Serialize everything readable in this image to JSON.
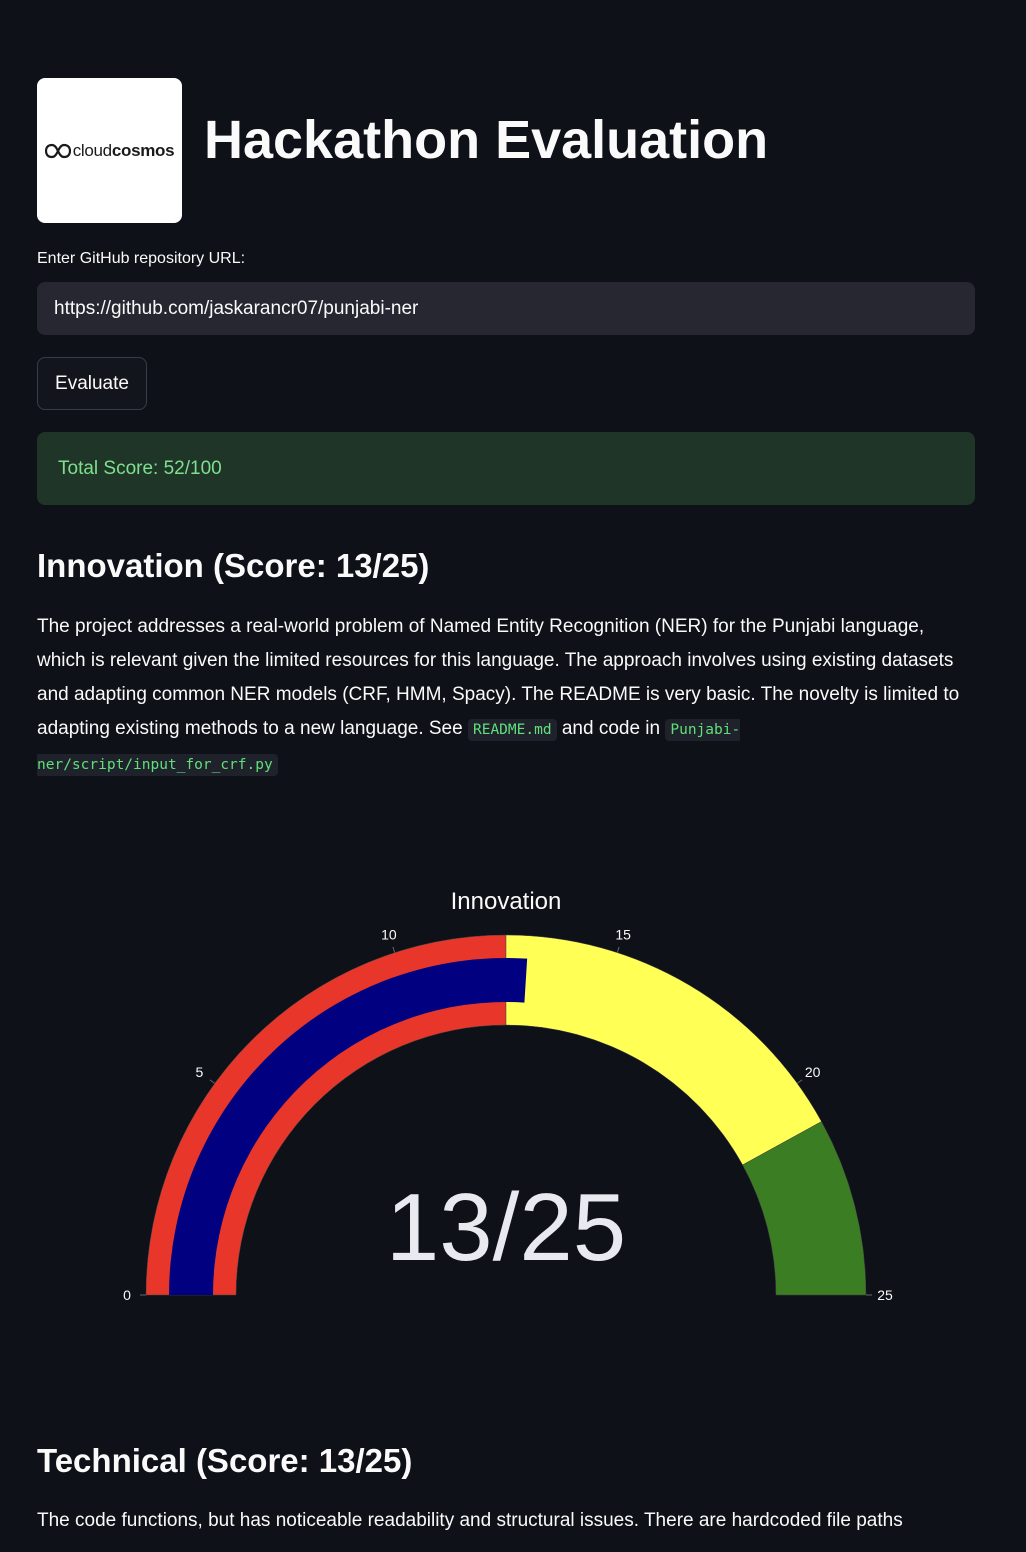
{
  "header": {
    "logo_text_light": "cloud",
    "logo_text_bold": "cosmos",
    "title": "Hackathon Evaluation"
  },
  "form": {
    "url_label": "Enter GitHub repository URL:",
    "url_value": "https://github.com/jaskarancr07/punjabi-ner",
    "evaluate_label": "Evaluate"
  },
  "total_score": "Total Score: 52/100",
  "innovation": {
    "heading": "Innovation (Score: 13/25)",
    "text_1": "The project addresses a real-world problem of Named Entity Recognition (NER) for the Punjabi language, which is relevant given the limited resources for this language. The approach involves using existing datasets and adapting common NER models (CRF, HMM, Spacy). The README is very basic. The novelty is limited to adapting existing methods to a new language. See ",
    "code_1": "README.md",
    "text_2": " and code in ",
    "code_2": "Punjabi-ner/script/input_for_crf.py"
  },
  "technical": {
    "heading": "Technical (Score: 13/25)",
    "text_1": "The code functions, but has noticeable readability and structural issues. There are hardcoded file paths"
  },
  "colors": {
    "red": "#e8372a",
    "yellow": "#ffff55",
    "green": "#3a7d23",
    "bar": "#000080"
  },
  "chart_data": {
    "type": "gauge",
    "title": "Innovation",
    "value": 13,
    "value_label": "13/25",
    "range": [
      0,
      25
    ],
    "ticks": [
      0,
      5,
      10,
      15,
      20,
      25
    ],
    "tick_labels": [
      "0",
      "5",
      "10",
      "15",
      "20",
      "25"
    ],
    "steps": [
      {
        "range": [
          0,
          12.5
        ],
        "color": "#e8372a"
      },
      {
        "range": [
          12.5,
          21
        ],
        "color": "#ffff55"
      },
      {
        "range": [
          21,
          25
        ],
        "color": "#3a7d23"
      }
    ],
    "bar_color": "#000080"
  }
}
